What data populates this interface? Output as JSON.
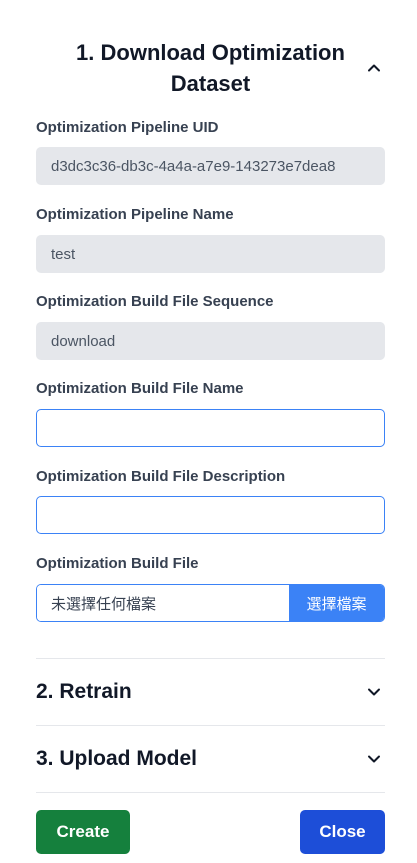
{
  "section1": {
    "title": "1. Download Optimization Dataset",
    "fields": {
      "pipeline_uid": {
        "label": "Optimization Pipeline UID",
        "value": "d3dc3c36-db3c-4a4a-a7e9-143273e7dea8"
      },
      "pipeline_name": {
        "label": "Optimization Pipeline Name",
        "value": "test"
      },
      "build_file_sequence": {
        "label": "Optimization Build File Sequence",
        "value": "download"
      },
      "build_file_name": {
        "label": "Optimization Build File Name",
        "value": ""
      },
      "build_file_description": {
        "label": "Optimization Build File Description",
        "value": ""
      },
      "build_file": {
        "label": "Optimization Build File",
        "file_status": "未選擇任何檔案",
        "choose_label": "選擇檔案"
      }
    }
  },
  "section2": {
    "title": "2. Retrain"
  },
  "section3": {
    "title": "3. Upload Model"
  },
  "footer": {
    "create_label": "Create",
    "close_label": "Close"
  },
  "icons": {
    "expanded": "chevron-up-icon",
    "collapsed": "chevron-down-icon"
  },
  "colors": {
    "accent": "#3b82f6",
    "create": "#15803d",
    "close": "#1d4ed8",
    "readonly_bg": "#e5e7eb"
  }
}
